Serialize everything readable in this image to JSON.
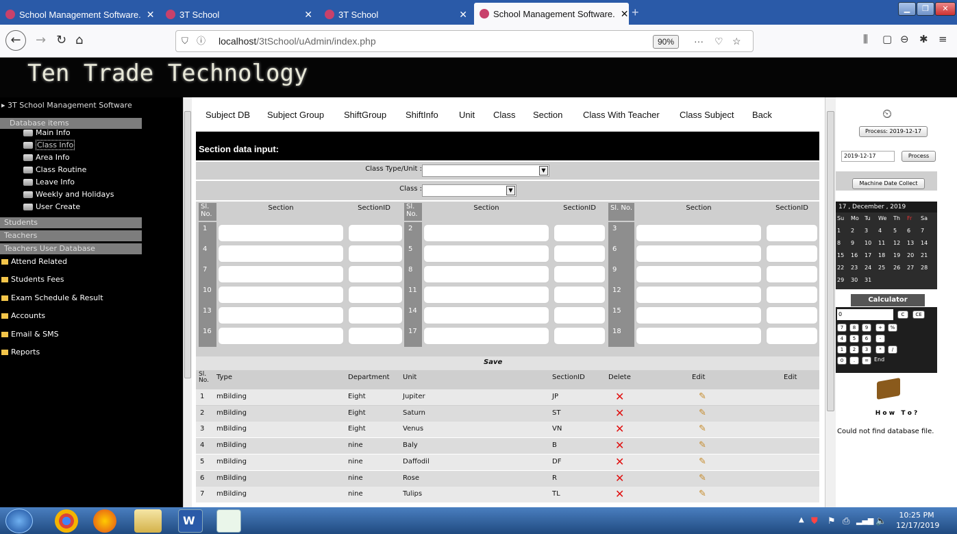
{
  "browser": {
    "tabs": [
      {
        "title": "School Management Software.",
        "active": false
      },
      {
        "title": "3T School",
        "active": false
      },
      {
        "title": "3T School",
        "active": false
      },
      {
        "title": "School Management Software.",
        "active": true
      }
    ],
    "url_prefix": "localhost",
    "url_path": "/3tSchool/uAdmin/index.php",
    "zoom": "90%"
  },
  "site": {
    "title": "Ten Trade Technology"
  },
  "sidebar": {
    "root": "3T School Management Software",
    "groups": [
      {
        "label": "Database items",
        "items": [
          "Main Info",
          "Class Info",
          "Area Info",
          "Class Routine",
          "Leave Info",
          "Weekly and Holidays",
          "User Create"
        ]
      }
    ],
    "collapsed": [
      "Students",
      "Teachers",
      "Teachers User Database"
    ],
    "folders": [
      "Attend Related",
      "Students Fees",
      "Exam Schedule & Result",
      "Accounts",
      "Email & SMS",
      "Reports"
    ]
  },
  "menu": [
    "Subject DB",
    "Subject Group",
    "ShiftGroup",
    "ShiftInfo",
    "Unit",
    "Class",
    "Section",
    "Class With Teacher",
    "Class Subject",
    "Back"
  ],
  "form": {
    "heading": "Section data input:",
    "class_type_label": "Class Type/Unit :",
    "class_label": "Class :",
    "headers": {
      "sl": "Sl. No.",
      "section": "Section",
      "section_id": "SectionID",
      "sl_inline": "Sl. No."
    },
    "row_numbers": [
      "1",
      "2",
      "3",
      "4",
      "5",
      "6",
      "7",
      "8",
      "9",
      "10",
      "11",
      "12",
      "13",
      "14",
      "15",
      "16",
      "17",
      "18"
    ],
    "save_label": "Save"
  },
  "list": {
    "headers": {
      "sl": "Sl. No.",
      "type": "Type",
      "department": "Department",
      "unit": "Unit",
      "section_id": "SectionID",
      "delete": "Delete",
      "edit1": "Edit",
      "edit2": "Edit"
    },
    "rows": [
      {
        "sl": "1",
        "type": "mBilding",
        "department": "Eight",
        "unit": "Jupiter",
        "section_id": "JP"
      },
      {
        "sl": "2",
        "type": "mBilding",
        "department": "Eight",
        "unit": "Saturn",
        "section_id": "ST"
      },
      {
        "sl": "3",
        "type": "mBilding",
        "department": "Eight",
        "unit": "Venus",
        "section_id": "VN"
      },
      {
        "sl": "4",
        "type": "mBilding",
        "department": "nine",
        "unit": "Baly",
        "section_id": "B"
      },
      {
        "sl": "5",
        "type": "mBilding",
        "department": "nine",
        "unit": "Daffodil",
        "section_id": "DF"
      },
      {
        "sl": "6",
        "type": "mBilding",
        "department": "nine",
        "unit": "Rose",
        "section_id": "R"
      },
      {
        "sl": "7",
        "type": "mBilding",
        "department": "nine",
        "unit": "Tulips",
        "section_id": "TL"
      }
    ]
  },
  "right": {
    "process_btn": "Process: 2019-12-17",
    "date_value": "2019-12-17",
    "process_label": "Process",
    "machine_btn": "Machine Date Collect",
    "cal_title": "17 , December , 2019",
    "weekdays": [
      "Su",
      "Mo",
      "Tu",
      "We",
      "Th",
      "Fr",
      "Sa"
    ],
    "weeks": [
      [
        "1",
        "2",
        "3",
        "4",
        "5",
        "6",
        "7"
      ],
      [
        "8",
        "9",
        "10",
        "11",
        "12",
        "13",
        "14"
      ],
      [
        "15",
        "16",
        "17",
        "18",
        "19",
        "20",
        "21"
      ],
      [
        "22",
        "23",
        "24",
        "25",
        "26",
        "27",
        "28"
      ],
      [
        "29",
        "30",
        "31",
        "",
        "",
        "",
        ""
      ]
    ],
    "calc_title": "Calculator",
    "calc_display": "0",
    "calc_c": "C",
    "calc_ce": "CE",
    "calc_keys": [
      "7",
      "8",
      "9",
      "+",
      "%",
      "4",
      "5",
      "6",
      "-",
      "1",
      "2",
      "3",
      "*",
      "/",
      "0",
      ".",
      "=",
      "End"
    ],
    "howto": "H o w   T o ?",
    "message": "Could not find database file."
  },
  "taskbar": {
    "time": "10:25 PM",
    "date": "12/17/2019"
  },
  "colors": {
    "tabbar": "#2a5aa8",
    "header": "#050505",
    "delete": "#e01010"
  }
}
